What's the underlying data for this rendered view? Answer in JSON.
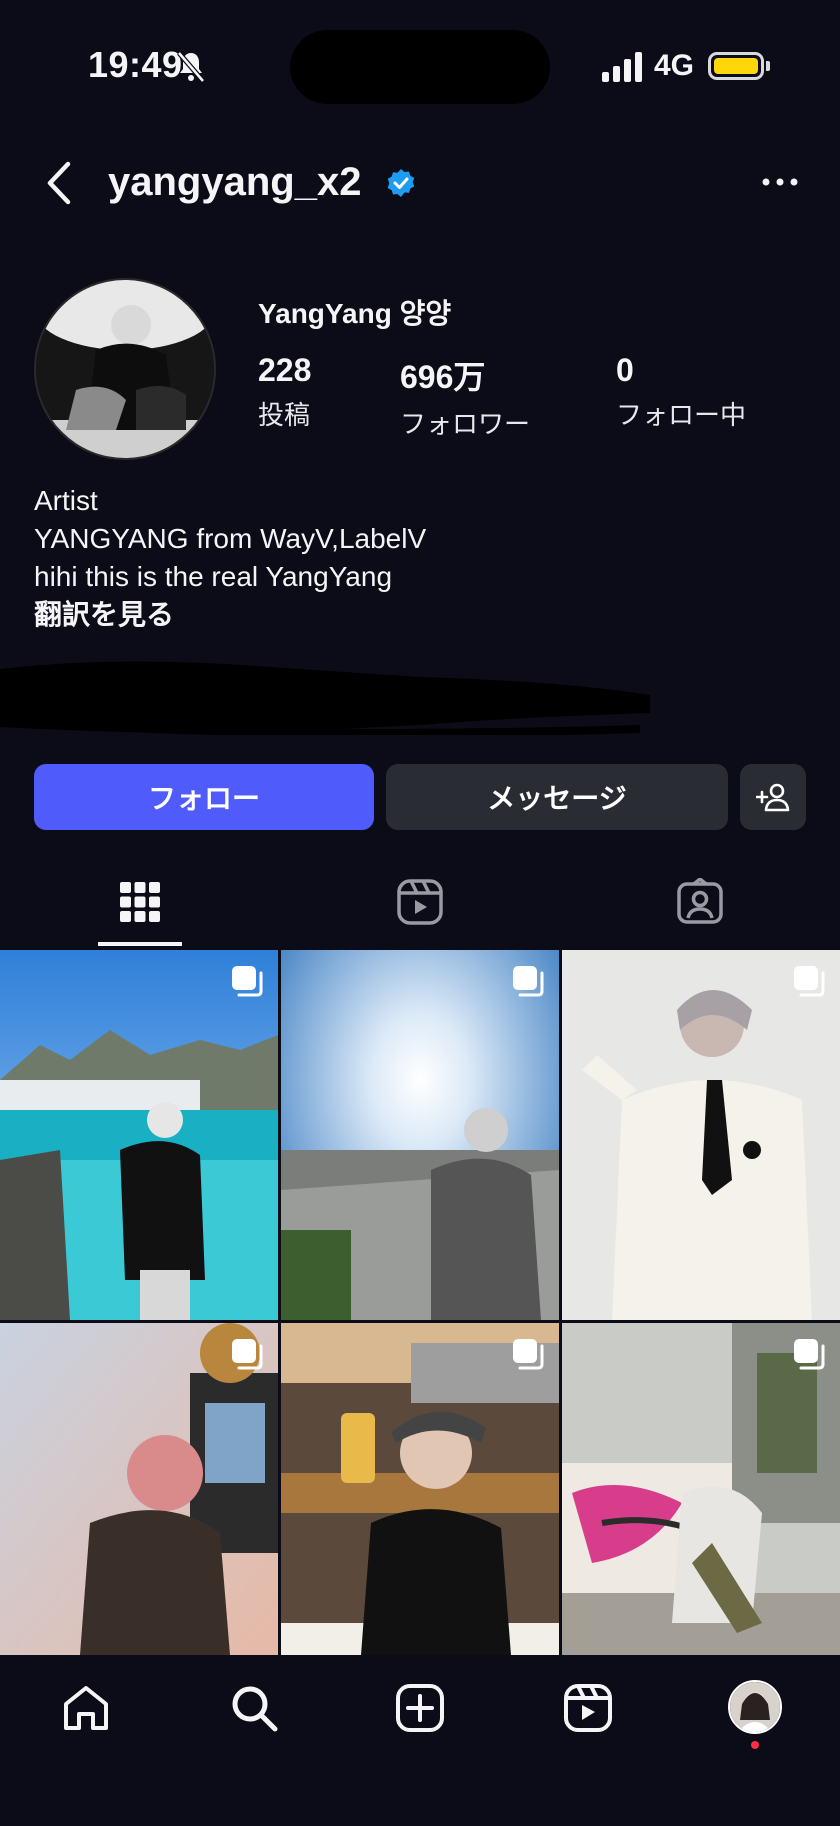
{
  "status_bar": {
    "time": "19:49",
    "network": "4G",
    "colors": {
      "battery": "#ffd60a"
    }
  },
  "header": {
    "username": "yangyang_x2",
    "verified": true
  },
  "profile": {
    "display_name": "YangYang 양양",
    "stats": [
      {
        "value": "228",
        "label": "投稿"
      },
      {
        "value": "696万",
        "label": "フォロワー"
      },
      {
        "value": "0",
        "label": "フォロー中"
      }
    ],
    "bio": [
      "Artist",
      "YANGYANG from WayV,LabelV",
      "hihi this is the real YangYang"
    ],
    "translate": "翻訳を見る"
  },
  "actions": {
    "follow": "フォロー",
    "message": "メッセージ"
  },
  "tabs": [
    {
      "icon": "grid-icon",
      "active": true
    },
    {
      "icon": "reels-icon",
      "active": false
    },
    {
      "icon": "tagged-icon",
      "active": false
    }
  ],
  "nav": [
    "home-icon",
    "search-icon",
    "create-icon",
    "reels-icon",
    "profile-avatar"
  ],
  "colors": {
    "accent": "#4f5cfb",
    "background": "#0c0c18",
    "secondary_button": "#2a2c33",
    "verified": "#1f9bf0"
  }
}
